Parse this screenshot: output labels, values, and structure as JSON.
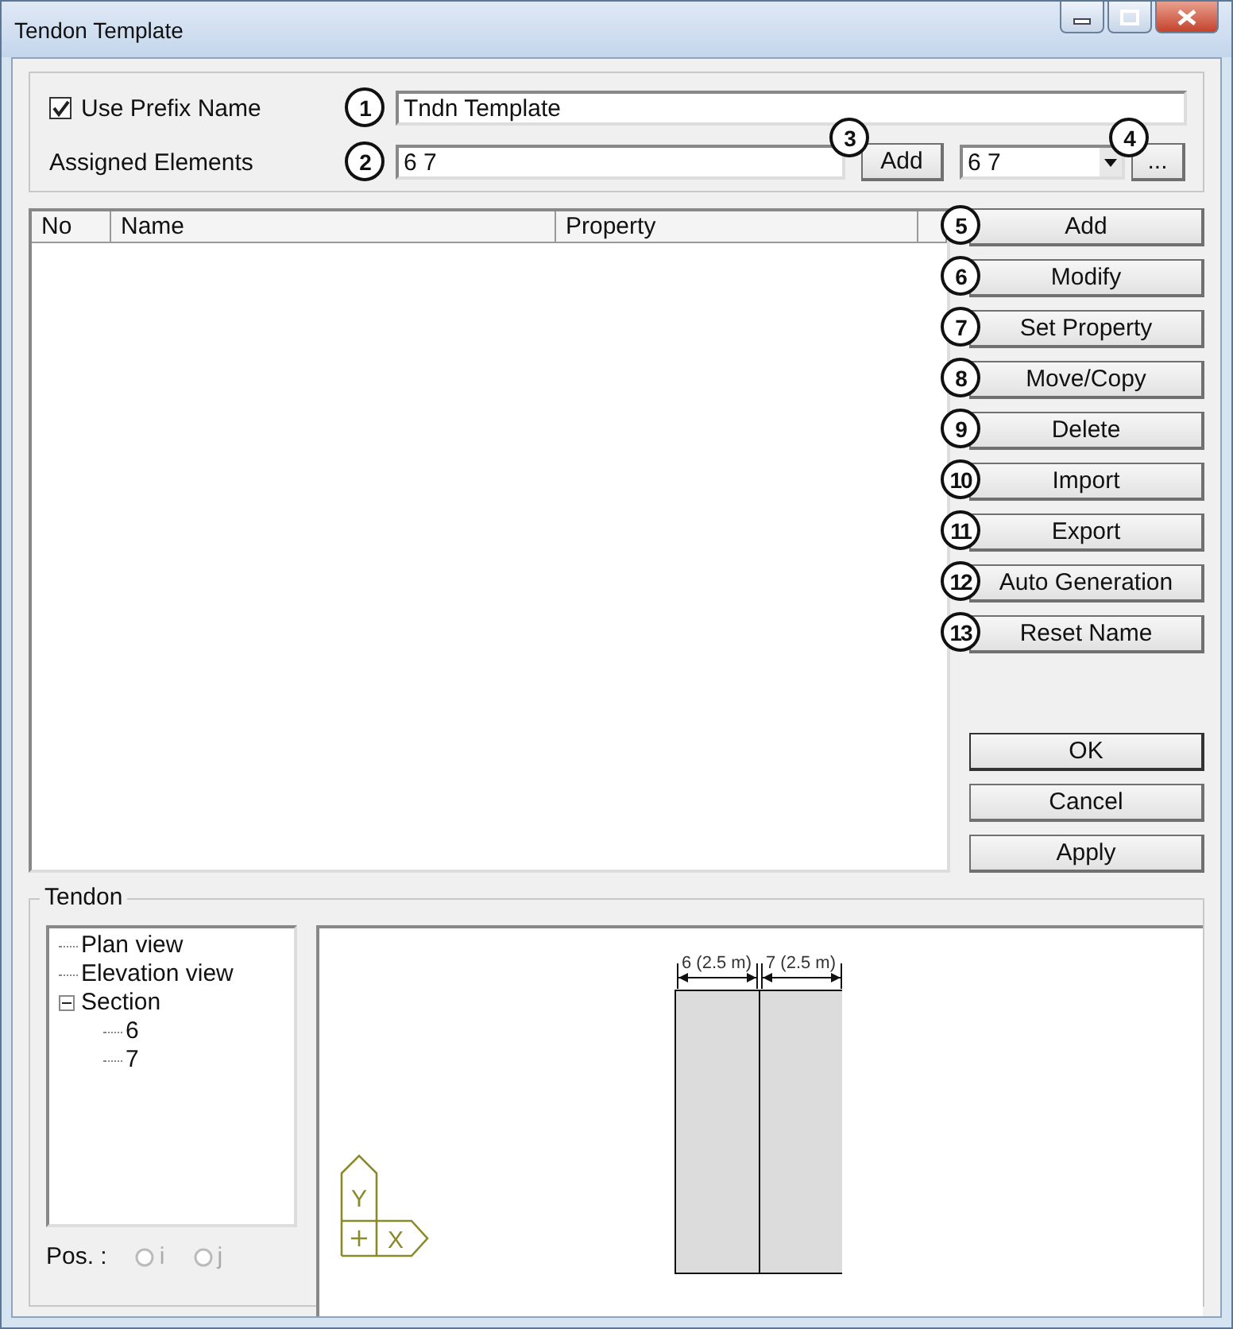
{
  "window": {
    "title": "Tendon Template"
  },
  "prefix": {
    "label": "Use Prefix Name",
    "checked": true,
    "value": "Tndn Template",
    "callout": "1"
  },
  "assigned": {
    "label": "Assigned Elements",
    "value": "6 7",
    "callout": "2",
    "add_button": "Add",
    "add_callout": "3",
    "combo_value": "6 7",
    "more_button": "...",
    "more_callout": "4"
  },
  "table": {
    "columns": [
      "No",
      "Name",
      "Property"
    ]
  },
  "buttons": [
    {
      "label": "Add",
      "callout": "5"
    },
    {
      "label": "Modify",
      "callout": "6"
    },
    {
      "label": "Set Property",
      "callout": "7"
    },
    {
      "label": "Move/Copy",
      "callout": "8"
    },
    {
      "label": "Delete",
      "callout": "9"
    },
    {
      "label": "Import",
      "callout": "10"
    },
    {
      "label": "Export",
      "callout": "11"
    },
    {
      "label": "Auto Generation",
      "callout": "12"
    },
    {
      "label": "Reset Name",
      "callout": "13"
    }
  ],
  "dialog_buttons": [
    "OK",
    "Cancel",
    "Apply"
  ],
  "tendon": {
    "title": "Tendon",
    "tree": [
      {
        "label": "Plan view"
      },
      {
        "label": "Elevation view"
      },
      {
        "label": "Section",
        "expanded": true,
        "children": [
          {
            "label": "6"
          },
          {
            "label": "7"
          }
        ]
      }
    ],
    "pos_label": "Pos. :",
    "radios": [
      {
        "label": "i",
        "selected": false,
        "disabled": true
      },
      {
        "label": "j",
        "selected": false,
        "disabled": true
      }
    ],
    "sections": [
      {
        "label": "6 (2.5 m)"
      },
      {
        "label": "7 (2.5 m)"
      }
    ],
    "axis": {
      "y": "Y",
      "x": "X"
    }
  }
}
